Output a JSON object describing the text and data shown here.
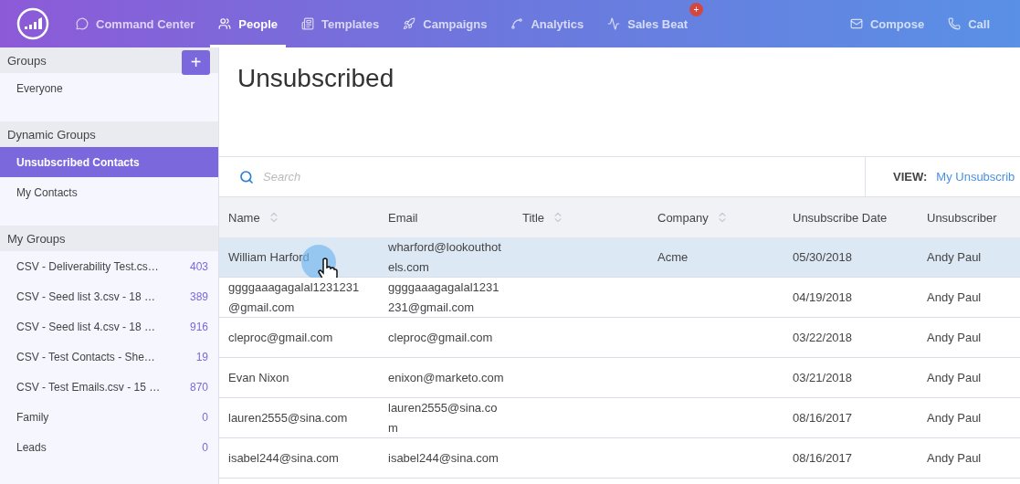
{
  "nav": {
    "items": [
      {
        "label": "Command Center",
        "selected": false
      },
      {
        "label": "People",
        "selected": true
      },
      {
        "label": "Templates",
        "selected": false
      },
      {
        "label": "Campaigns",
        "selected": false
      },
      {
        "label": "Analytics",
        "selected": false
      },
      {
        "label": "Sales Beat",
        "selected": false,
        "badge": "+"
      }
    ],
    "actions": [
      {
        "label": "Compose"
      },
      {
        "label": "Call"
      }
    ]
  },
  "sidebar": {
    "add_button": "+",
    "sections": [
      {
        "title": "Groups",
        "items": [
          {
            "label": "Everyone",
            "selected": false
          }
        ]
      },
      {
        "title": "Dynamic Groups",
        "items": [
          {
            "label": "Unsubscribed Contacts",
            "selected": true
          },
          {
            "label": "My Contacts",
            "selected": false
          }
        ]
      },
      {
        "title": "My Groups",
        "items": [
          {
            "label": "CSV - Deliverability Test.cs…",
            "count": "403",
            "selected": false
          },
          {
            "label": "CSV - Seed list 3.csv - 18 …",
            "count": "389",
            "selected": false
          },
          {
            "label": "CSV - Seed list 4.csv - 18 …",
            "count": "916",
            "selected": false
          },
          {
            "label": "CSV - Test Contacts - She…",
            "count": "19",
            "selected": false
          },
          {
            "label": "CSV - Test Emails.csv - 15 …",
            "count": "870",
            "selected": false
          },
          {
            "label": "Family",
            "count": "0",
            "selected": false
          },
          {
            "label": "Leads",
            "count": "0",
            "selected": false
          }
        ]
      }
    ]
  },
  "page": {
    "title": "Unsubscribed",
    "search": {
      "placeholder": "Search"
    },
    "view": {
      "label": "VIEW:",
      "value": "My Unsubscrib"
    }
  },
  "table": {
    "columns": [
      {
        "label": "Name",
        "sortable": true
      },
      {
        "label": "Email",
        "sortable": false
      },
      {
        "label": "Title",
        "sortable": true
      },
      {
        "label": "Company",
        "sortable": true
      },
      {
        "label": "Unsubscribe Date",
        "sortable": false
      },
      {
        "label": "Unsubscriber",
        "sortable": false
      }
    ],
    "rows": [
      {
        "selected": true,
        "cells": [
          "William Harford",
          "wharford@lookouthotels.com",
          "",
          "Acme",
          "05/30/2018",
          "Andy Paul"
        ]
      },
      {
        "selected": false,
        "cells": [
          "ggggaaagagalal1231231@gmail.com",
          "ggggaaagagalal1231231@gmail.com",
          "",
          "",
          "04/19/2018",
          "Andy Paul"
        ]
      },
      {
        "selected": false,
        "cells": [
          "cleproc@gmail.com",
          "cleproc@gmail.com",
          "",
          "",
          "03/22/2018",
          "Andy Paul"
        ]
      },
      {
        "selected": false,
        "cells": [
          "Evan Nixon",
          "enixon@marketo.com",
          "",
          "",
          "03/21/2018",
          "Andy Paul"
        ]
      },
      {
        "selected": false,
        "cells": [
          "lauren2555@sina.com",
          "lauren2555@sina.com",
          "",
          "",
          "08/16/2017",
          "Andy Paul"
        ]
      },
      {
        "selected": false,
        "cells": [
          "isabel244@sina.com",
          "isabel244@sina.com",
          "",
          "",
          "08/16/2017",
          "Andy Paul"
        ]
      }
    ]
  }
}
